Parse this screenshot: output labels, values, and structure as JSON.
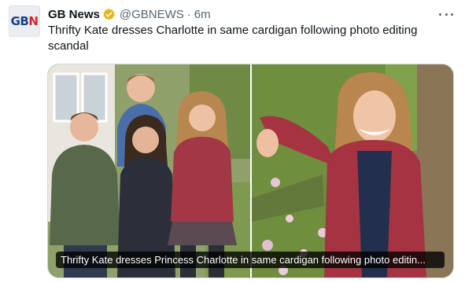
{
  "tweet": {
    "avatar_logo": {
      "left": "GB",
      "right": "N"
    },
    "display_name": "GB News",
    "verified_icon": "verified-badge-gold",
    "handle": "@GBNEWS",
    "separator": "·",
    "time": "6m",
    "more_icon": "more-horizontal-icon",
    "text": "Thrifty Kate dresses Charlotte in same cardigan following photo editing scandal",
    "media": {
      "left_photo": "family-photo",
      "right_photo": "charlotte-portrait",
      "caption": "Thrifty Kate dresses Princess Charlotte in same cardigan following photo editin..."
    }
  },
  "colors": {
    "text_primary": "#0f1419",
    "text_secondary": "#536471",
    "verified_gold": "#e2b719",
    "media_border": "#cfd9de",
    "brand_blue": "#1b3e8c",
    "brand_red": "#d6202a"
  }
}
